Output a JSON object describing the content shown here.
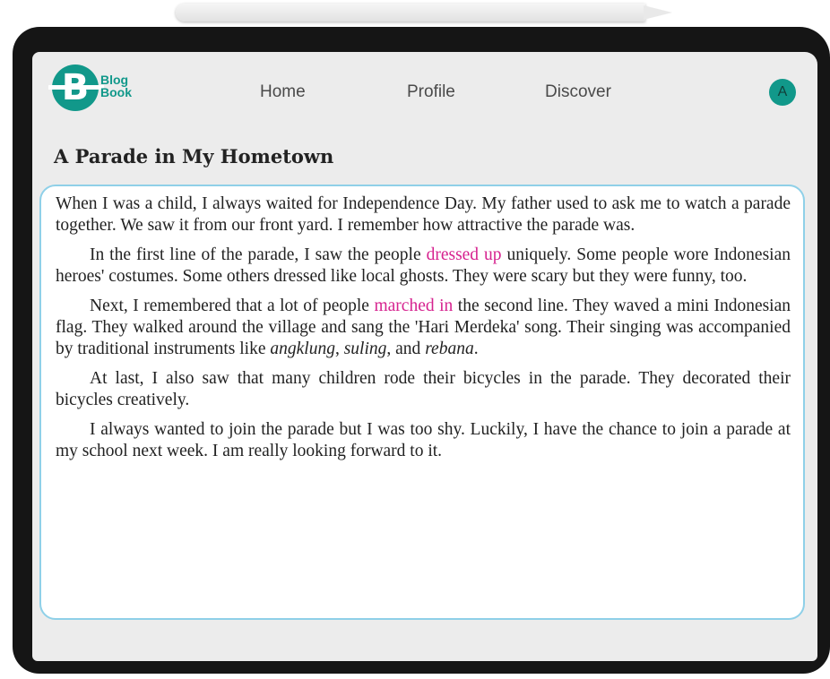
{
  "nav": {
    "logo_letter": "B",
    "logo_line1": "Blog",
    "logo_line2": "Book",
    "links": [
      "Home",
      "Profile",
      "Discover"
    ],
    "avatar_initial": "A"
  },
  "article": {
    "title": "A Parade in My Hometown",
    "p1": "When I was a child, I always waited for Independence Day. My father used to ask me to watch a parade together. We saw it from our front yard. I remember how attractive the parade was.",
    "p2_a": "In the first line of the parade, I saw the people ",
    "p2_hl": "dressed up",
    "p2_b": " uniquely. Some people wore Indonesian heroes' costumes. Some others dressed like local ghosts. They were scary but they were funny, too.",
    "p3_a": "Next, I remembered that a lot of people ",
    "p3_hl": "marched in",
    "p3_b": " the second line. They waved a mini Indonesian flag. They walked around the village and sang the 'Hari Merdeka' song. Their singing was accompanied by traditional instruments like ",
    "p3_i1": "angklung",
    "p3_c": ", ",
    "p3_i2": "suling",
    "p3_d": ", and ",
    "p3_i3": "rebana",
    "p3_e": ".",
    "p4": "At last, I also saw that many children rode their bicycles in the parade. They decorated their bicycles creatively.",
    "p5": "I always wanted to join the parade but I was too shy. Luckily, I have the chance to join a parade at my school next week. I am really looking forward to it."
  },
  "colors": {
    "brand": "#11988a",
    "highlight": "#d6228f",
    "content_border": "#8fd0e8"
  }
}
